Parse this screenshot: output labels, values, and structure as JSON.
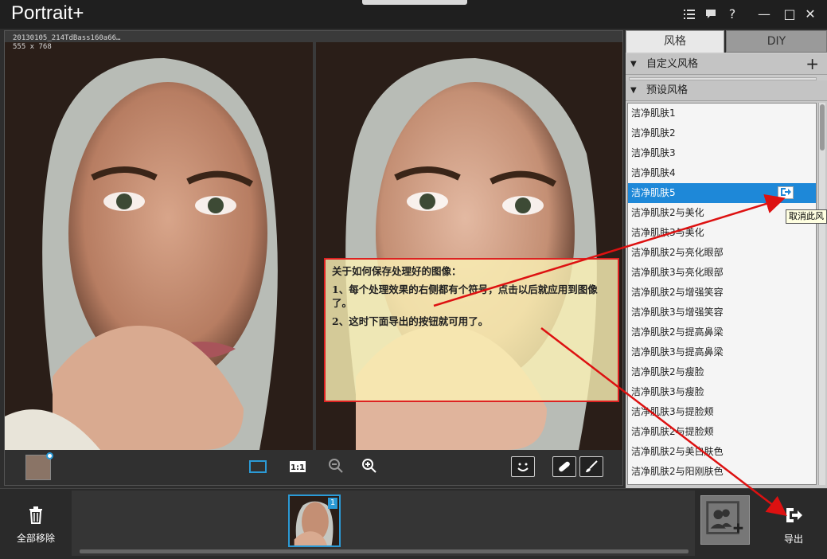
{
  "app": {
    "title": "Portrait+"
  },
  "titlebar": {
    "menu_icon": "list-icon",
    "feedback_icon": "chat-icon",
    "help_label": "?",
    "minimize_label": "—",
    "maximize_label": "□",
    "close_label": "✕"
  },
  "canvas": {
    "file_name": "20130105_214TdBass160a66…",
    "dimensions": "555 x 768"
  },
  "note": {
    "line1": "关于如何保存处理好的图像：",
    "line2": "1、每个处理效果的右侧都有个符号，点击以后就应用到图像了。",
    "line3": "2、这时下面导出的按钮就可用了。"
  },
  "panel": {
    "tab_style": "风格",
    "tab_diy": "DIY",
    "custom_section": "自定义风格",
    "preset_section": "预设风格",
    "styles": [
      "洁净肌肤1",
      "洁净肌肤2",
      "洁净肌肤3",
      "洁净肌肤4",
      "洁净肌肤5",
      "洁净肌肤2与美化",
      "洁净肌肤3与美化",
      "洁净肌肤2与亮化眼部",
      "洁净肌肤3与亮化眼部",
      "洁净肌肤2与增强笑容",
      "洁净肌肤3与增强笑容",
      "洁净肌肤2与提高鼻梁",
      "洁净肌肤3与提高鼻梁",
      "洁净肌肤2与瘦脸",
      "洁净肌肤3与瘦脸",
      "洁净肌肤3与提脸颊",
      "洁净肌肤2与提脸颊",
      "洁净肌肤2与美白肤色",
      "洁净肌肤2与阳刚肤色"
    ],
    "selected_index": 4,
    "tooltip": "取消此风"
  },
  "bottom": {
    "remove_all": "全部移除",
    "export": "导出",
    "thumb_badge": "1"
  },
  "colors": {
    "accent": "#1e88d8",
    "note_border": "#dd2222",
    "arrow": "#dd1111"
  }
}
